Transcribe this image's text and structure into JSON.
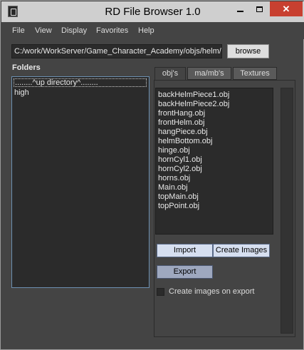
{
  "window": {
    "title": "RD File Browser 1.0",
    "minimize_glyph": "",
    "close_glyph": "✕"
  },
  "menu": {
    "items": [
      "File",
      "View",
      "Display",
      "Favorites",
      "Help"
    ]
  },
  "path": {
    "value": "C:/work/WorkServer/Game_Character_Academy/objs/helm/",
    "browse_label": "browse"
  },
  "folders": {
    "label": "Folders",
    "items": [
      "........^up directory^........",
      "high"
    ]
  },
  "tabs": [
    "obj's",
    "ma/mb's",
    "Textures"
  ],
  "active_tab": "obj's",
  "files": [
    "backHelmPiece1.obj",
    "backHelmPiece2.obj",
    "frontHang.obj",
    "frontHelm.obj",
    "hangPiece.obj",
    "helmBottom.obj",
    "hinge.obj",
    "hornCyl1.obj",
    "hornCyl2.obj",
    "horns.obj",
    "Main.obj",
    "topMain.obj",
    "topPoint.obj"
  ],
  "actions": {
    "import_label": "Import",
    "create_images_label": "Create Images",
    "export_label": "Export"
  },
  "options": {
    "create_images_on_export_label": "Create images on export",
    "create_images_on_export_checked": false
  },
  "colors": {
    "window_bg": "#444444",
    "list_bg": "#2b2b2b",
    "titlebar_bg": "#cfcfcf",
    "close_btn": "#c84030",
    "button_light": "#d6dff0",
    "button_export": "#9ea8bf",
    "folder_border": "#6c8fb0"
  }
}
